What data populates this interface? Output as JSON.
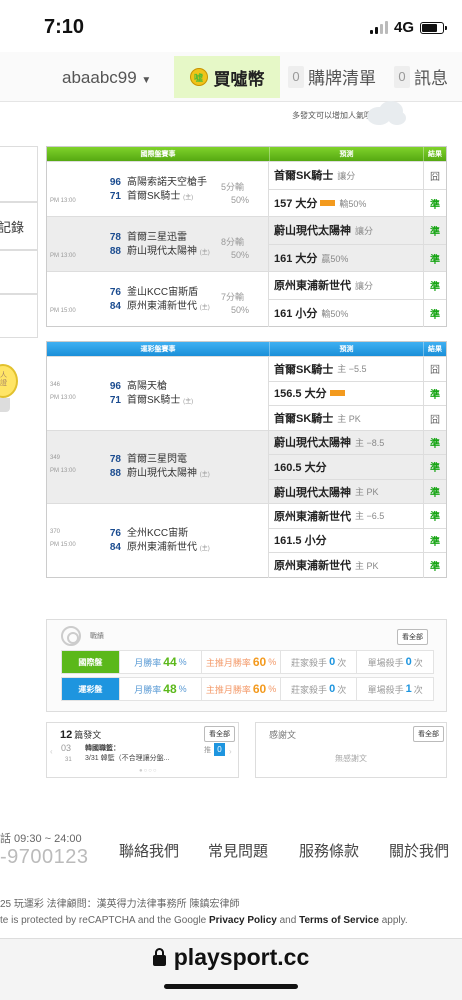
{
  "status": {
    "time": "7:10",
    "network": "4G"
  },
  "nav": {
    "username": "abaabc99",
    "buy_coin": "買噓幣",
    "cart_count": "0",
    "cart_label": "購牌清單",
    "msg_count": "0",
    "msg_label": "訊息"
  },
  "left_stub": {
    "record_text": "記錄",
    "bulb_text": "人\n證"
  },
  "hint": "多發文可以增加人氣哦~",
  "intl": {
    "headers": {
      "match": "國際盤賽事",
      "prediction": "預測",
      "result": "結果"
    },
    "games": [
      {
        "time": "PM 13:00",
        "away_num": "96",
        "away": "高陽索諾天空槍手",
        "home_num": "71",
        "home": "首爾SK騎士",
        "home_tag": "(主)",
        "gain": "5分輸",
        "gain2": "50%",
        "picks": [
          {
            "text": "首爾SK騎士",
            "sub": "讓分",
            "hot": false,
            "result": "囧",
            "ok": false
          },
          {
            "text": "157 大分",
            "sub": "輸50%",
            "hot": true,
            "result": "準",
            "ok": true
          }
        ]
      },
      {
        "time": "PM 13:00",
        "away_num": "78",
        "away": "首爾三星迅雷",
        "home_num": "88",
        "home": "蔚山現代太陽神",
        "home_tag": "(主)",
        "gain": "8分輸",
        "gain2": "50%",
        "picks": [
          {
            "text": "蔚山現代太陽神",
            "sub": "讓分",
            "hot": false,
            "result": "準",
            "ok": true
          },
          {
            "text": "161 大分",
            "sub": "贏50%",
            "hot": false,
            "result": "準",
            "ok": true
          }
        ]
      },
      {
        "time": "PM 15:00",
        "away_num": "76",
        "away": "釜山KCC宙斯盾",
        "home_num": "84",
        "home": "原州東浦新世代",
        "home_tag": "(主)",
        "gain": "7分輸",
        "gain2": "50%",
        "picks": [
          {
            "text": "原州東浦新世代",
            "sub": "讓分",
            "hot": false,
            "result": "準",
            "ok": true
          },
          {
            "text": "161 小分",
            "sub": "輸50%",
            "hot": false,
            "result": "準",
            "ok": true
          }
        ]
      }
    ]
  },
  "lottery": {
    "headers": {
      "match": "運彩盤賽事",
      "prediction": "預測",
      "result": "結果"
    },
    "games": [
      {
        "num": "346",
        "time": "PM 13:00",
        "away_num": "96",
        "away": "高陽天槍",
        "home_num": "71",
        "home": "首爾SK騎士",
        "home_tag": "(主)",
        "picks": [
          {
            "text": "首爾SK騎士",
            "sub": "主 −5.5",
            "hot": false,
            "result": "囧",
            "ok": false
          },
          {
            "text": "156.5 大分",
            "sub": "",
            "hot": true,
            "result": "準",
            "ok": true
          },
          {
            "text": "首爾SK騎士",
            "sub": "主 PK",
            "hot": false,
            "result": "囧",
            "ok": false
          }
        ]
      },
      {
        "num": "349",
        "time": "PM 13:00",
        "away_num": "78",
        "away": "首爾三星閃電",
        "home_num": "88",
        "home": "蔚山現代太陽神",
        "home_tag": "(主)",
        "picks": [
          {
            "text": "蔚山現代太陽神",
            "sub": "主 −8.5",
            "hot": false,
            "result": "準",
            "ok": true
          },
          {
            "text": "160.5 大分",
            "sub": "",
            "hot": false,
            "result": "準",
            "ok": true
          },
          {
            "text": "蔚山現代太陽神",
            "sub": "主 PK",
            "hot": false,
            "result": "準",
            "ok": true
          }
        ]
      },
      {
        "num": "370",
        "time": "PM 15:00",
        "away_num": "76",
        "away": "全州KCC宙斯",
        "home_num": "84",
        "home": "原州東浦新世代",
        "home_tag": "(主)",
        "picks": [
          {
            "text": "原州東浦新世代",
            "sub": "主 −6.5",
            "hot": false,
            "result": "準",
            "ok": true
          },
          {
            "text": "161.5 小分",
            "sub": "",
            "hot": false,
            "result": "準",
            "ok": true
          },
          {
            "text": "原州東浦新世代",
            "sub": "主 PK",
            "hot": false,
            "result": "準",
            "ok": true
          }
        ]
      }
    ]
  },
  "stats": {
    "title": "戰績",
    "view_all": "看全部",
    "rows": [
      {
        "label": "國際盤",
        "month_prefix": "月勝率",
        "month_val": "44",
        "month_suffix": "%",
        "main_prefix": "主推月勝率",
        "main_val": "60",
        "main_suffix": "%",
        "zhuang_prefix": "莊家殺手",
        "zhuang_val": "0",
        "zhuang_suffix": "次",
        "single_prefix": "單場殺手",
        "single_val": "0",
        "single_suffix": "次"
      },
      {
        "label": "運彩盤",
        "month_prefix": "月勝率",
        "month_val": "48",
        "month_suffix": "%",
        "main_prefix": "主推月勝率",
        "main_val": "60",
        "main_suffix": "%",
        "zhuang_prefix": "莊家殺手",
        "zhuang_val": "0",
        "zhuang_suffix": "次",
        "single_prefix": "單場殺手",
        "single_val": "1",
        "single_suffix": "次"
      }
    ]
  },
  "posts": {
    "count": "12",
    "title": "篇發文",
    "view_all": "看全部",
    "date_month": "03",
    "date_day": "31",
    "post_title": "韓國職籃：",
    "post_sub": "3/31 韓籃（不合理讓分盤...",
    "push_label": "推",
    "push_count": "0"
  },
  "thanks": {
    "title": "感謝文",
    "view_all": "看全部",
    "empty": "無感謝文"
  },
  "footer": {
    "tel_hours": "話 09:30 ~ 24:00",
    "tel": "-9700123",
    "links": [
      "聯絡我們",
      "常見問題",
      "服務條款",
      "關於我們"
    ],
    "copyright": "25 玩運彩 法律顧問：漢英得力法律事務所 陳鎮宏律師",
    "recaptcha_pre": "te is protected by reCAPTCHA and the Google ",
    "privacy": "Privacy Policy",
    "and": " and ",
    "terms": "Terms of Service",
    "apply": " apply."
  },
  "browser": {
    "url": "playsport.cc"
  },
  "colors": {
    "intl_header": "#55a812",
    "lottery_header": "#1a8fd8",
    "win": "#18a515",
    "buy_coin_bg": "#e6f8c7"
  }
}
